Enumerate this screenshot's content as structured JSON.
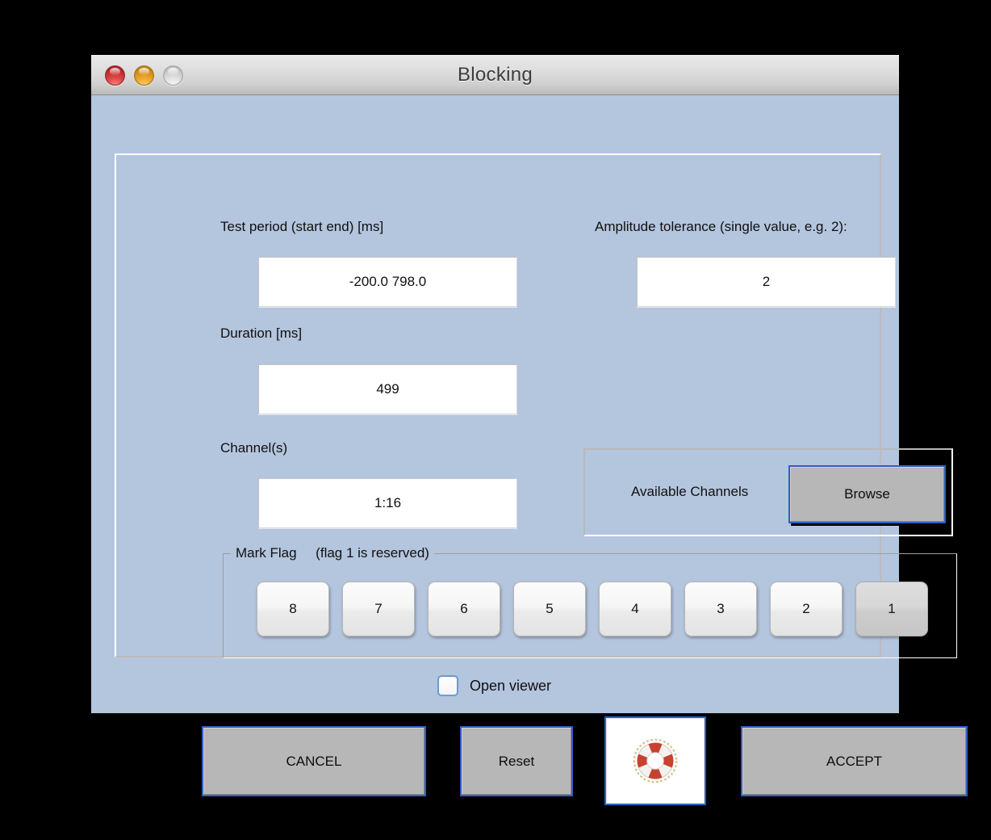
{
  "window": {
    "title": "Blocking",
    "traffic_lights": [
      {
        "name": "close",
        "color": "#d14343"
      },
      {
        "name": "minimize",
        "color": "#e8a72b"
      },
      {
        "name": "maximize",
        "color": "#dcdcdc"
      }
    ]
  },
  "colors": {
    "window_background": "#b4c5de",
    "button_face": "#b7b7b7",
    "focus_border": "#2f5fc4",
    "field_background": "#ffffff",
    "text": "#101010"
  },
  "fields": {
    "test_period": {
      "label": "Test period (start end) [ms]",
      "value": "-200.0  798.0"
    },
    "amplitude_tolerance": {
      "label": "Amplitude tolerance (single value, e.g. 2):",
      "value": "2"
    },
    "duration": {
      "label": "Duration [ms]",
      "value": "499"
    },
    "channels": {
      "label": "Channel(s)",
      "value": "1:16"
    }
  },
  "available_channels": {
    "label": "Available Channels",
    "browse_label": "Browse"
  },
  "mark_flag": {
    "legend": "Mark Flag     (flag 1 is reserved)",
    "buttons": [
      {
        "label": "8",
        "disabled": false
      },
      {
        "label": "7",
        "disabled": false
      },
      {
        "label": "6",
        "disabled": false
      },
      {
        "label": "5",
        "disabled": false
      },
      {
        "label": "4",
        "disabled": false
      },
      {
        "label": "3",
        "disabled": false
      },
      {
        "label": "2",
        "disabled": false
      },
      {
        "label": "1",
        "disabled": true
      }
    ]
  },
  "open_viewer": {
    "label": "Open viewer",
    "checked": false
  },
  "footer": {
    "cancel_label": "CANCEL",
    "reset_label": "Reset",
    "accept_label": "ACCEPT",
    "help_icon": "lifebuoy-icon"
  }
}
